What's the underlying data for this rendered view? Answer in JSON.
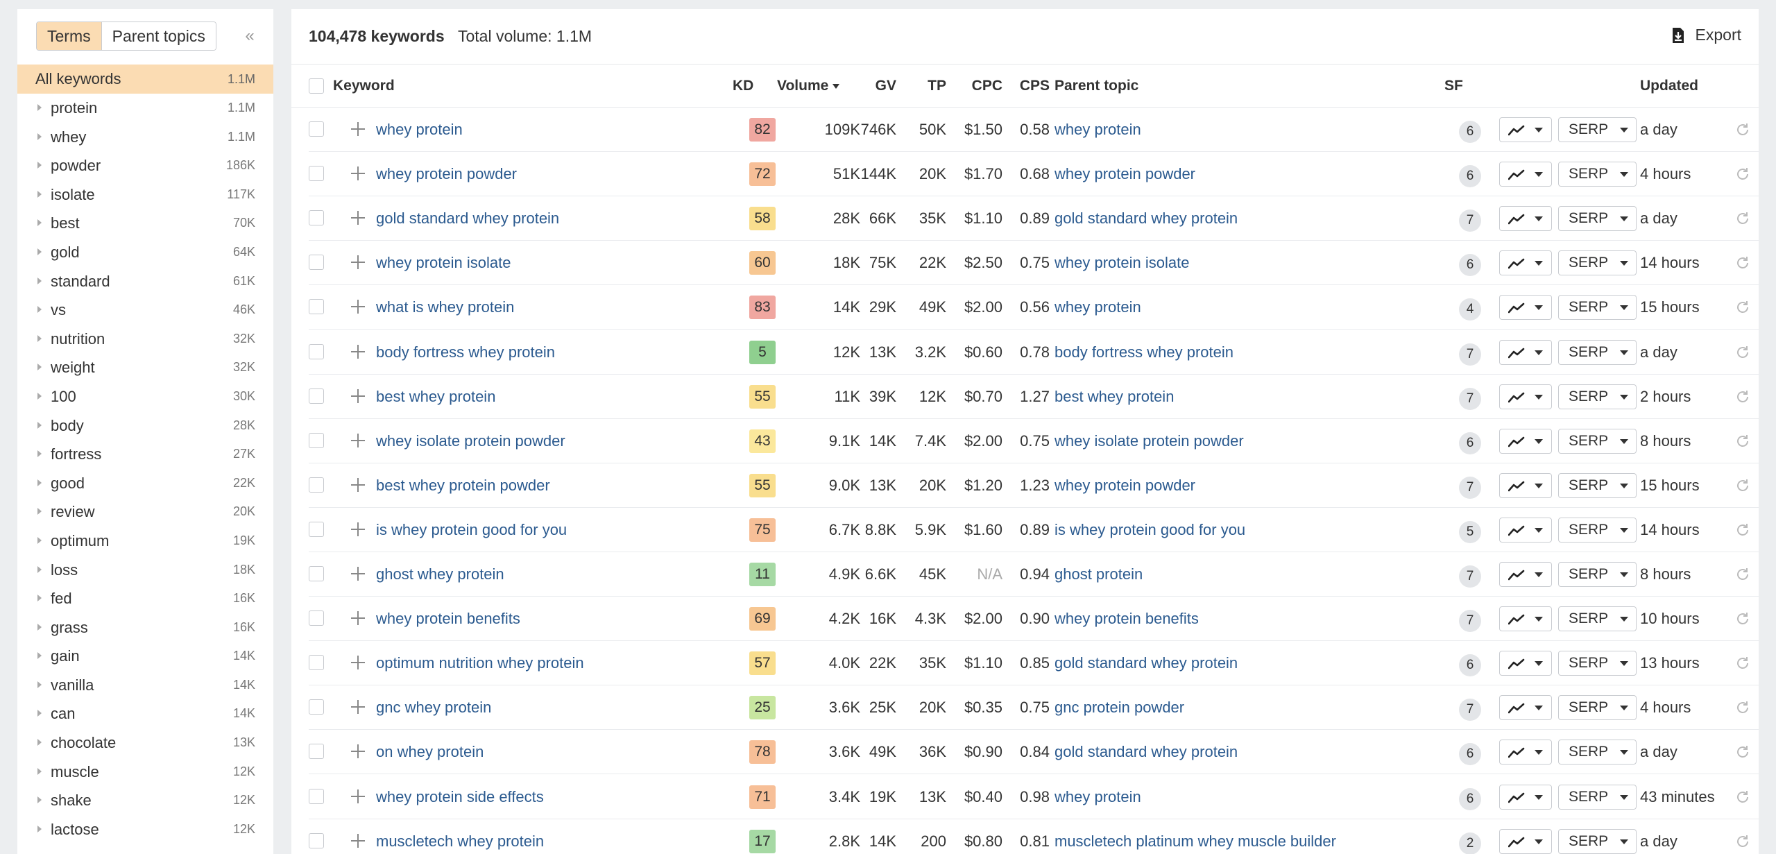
{
  "sidebar": {
    "tabs": [
      "Terms",
      "Parent topics"
    ],
    "all": {
      "label": "All keywords",
      "count": "1.1M"
    },
    "items": [
      {
        "label": "protein",
        "count": "1.1M"
      },
      {
        "label": "whey",
        "count": "1.1M"
      },
      {
        "label": "powder",
        "count": "186K"
      },
      {
        "label": "isolate",
        "count": "117K"
      },
      {
        "label": "best",
        "count": "70K"
      },
      {
        "label": "gold",
        "count": "64K"
      },
      {
        "label": "standard",
        "count": "61K"
      },
      {
        "label": "vs",
        "count": "46K"
      },
      {
        "label": "nutrition",
        "count": "32K"
      },
      {
        "label": "weight",
        "count": "32K"
      },
      {
        "label": "100",
        "count": "30K"
      },
      {
        "label": "body",
        "count": "28K"
      },
      {
        "label": "fortress",
        "count": "27K"
      },
      {
        "label": "good",
        "count": "22K"
      },
      {
        "label": "review",
        "count": "20K"
      },
      {
        "label": "optimum",
        "count": "19K"
      },
      {
        "label": "loss",
        "count": "18K"
      },
      {
        "label": "fed",
        "count": "16K"
      },
      {
        "label": "grass",
        "count": "16K"
      },
      {
        "label": "gain",
        "count": "14K"
      },
      {
        "label": "vanilla",
        "count": "14K"
      },
      {
        "label": "can",
        "count": "14K"
      },
      {
        "label": "chocolate",
        "count": "13K"
      },
      {
        "label": "muscle",
        "count": "12K"
      },
      {
        "label": "shake",
        "count": "12K"
      },
      {
        "label": "lactose",
        "count": "12K"
      }
    ]
  },
  "header": {
    "keyword_count": "104,478 keywords",
    "total_volume": "Total volume: 1.1M",
    "export_label": "Export"
  },
  "columns": {
    "keyword": "Keyword",
    "kd": "KD",
    "volume": "Volume",
    "gv": "GV",
    "tp": "TP",
    "cpc": "CPC",
    "cps": "CPS",
    "parent_topic": "Parent topic",
    "sf": "SF",
    "updated": "Updated"
  },
  "kd_colors": {
    "red": "#f0a7a0",
    "orange": "#f7bf97",
    "yellow": "#f9de8e",
    "light_yellow": "#fbe89c",
    "green": "#a6d9a4",
    "light_green": "#c8e6a0"
  },
  "serp_label": "SERP",
  "rows": [
    {
      "keyword": "whey protein",
      "kd": "82",
      "kd_color": "#f0a7a0",
      "volume": "109K",
      "gv": "746K",
      "tp": "50K",
      "cpc": "$1.50",
      "cps": "0.58",
      "parent": "whey protein",
      "sf": "6",
      "updated": "a day"
    },
    {
      "keyword": "whey protein powder",
      "kd": "72",
      "kd_color": "#f7bf97",
      "volume": "51K",
      "gv": "144K",
      "tp": "20K",
      "cpc": "$1.70",
      "cps": "0.68",
      "parent": "whey protein powder",
      "sf": "6",
      "updated": "4 hours"
    },
    {
      "keyword": "gold standard whey protein",
      "kd": "58",
      "kd_color": "#f9de8e",
      "volume": "28K",
      "gv": "66K",
      "tp": "35K",
      "cpc": "$1.10",
      "cps": "0.89",
      "parent": "gold standard whey protein",
      "sf": "7",
      "updated": "a day"
    },
    {
      "keyword": "whey protein isolate",
      "kd": "60",
      "kd_color": "#f7c792",
      "volume": "18K",
      "gv": "75K",
      "tp": "22K",
      "cpc": "$2.50",
      "cps": "0.75",
      "parent": "whey protein isolate",
      "sf": "6",
      "updated": "14 hours"
    },
    {
      "keyword": "what is whey protein",
      "kd": "83",
      "kd_color": "#f0a7a0",
      "volume": "14K",
      "gv": "29K",
      "tp": "49K",
      "cpc": "$2.00",
      "cps": "0.56",
      "parent": "whey protein",
      "sf": "4",
      "updated": "15 hours"
    },
    {
      "keyword": "body fortress whey protein",
      "kd": "5",
      "kd_color": "#8fcf8f",
      "volume": "12K",
      "gv": "13K",
      "tp": "3.2K",
      "cpc": "$0.60",
      "cps": "0.78",
      "parent": "body fortress whey protein",
      "sf": "7",
      "updated": "a day"
    },
    {
      "keyword": "best whey protein",
      "kd": "55",
      "kd_color": "#f9de8e",
      "volume": "11K",
      "gv": "39K",
      "tp": "12K",
      "cpc": "$0.70",
      "cps": "1.27",
      "parent": "best whey protein",
      "sf": "7",
      "updated": "2 hours"
    },
    {
      "keyword": "whey isolate protein powder",
      "kd": "43",
      "kd_color": "#fbe89c",
      "volume": "9.1K",
      "gv": "14K",
      "tp": "7.4K",
      "cpc": "$2.00",
      "cps": "0.75",
      "parent": "whey isolate protein powder",
      "sf": "6",
      "updated": "8 hours"
    },
    {
      "keyword": "best whey protein powder",
      "kd": "55",
      "kd_color": "#f9de8e",
      "volume": "9.0K",
      "gv": "13K",
      "tp": "20K",
      "cpc": "$1.20",
      "cps": "1.23",
      "parent": "whey protein powder",
      "sf": "7",
      "updated": "15 hours"
    },
    {
      "keyword": "is whey protein good for you",
      "kd": "75",
      "kd_color": "#f7bf97",
      "volume": "6.7K",
      "gv": "8.8K",
      "tp": "5.9K",
      "cpc": "$1.60",
      "cps": "0.89",
      "parent": "is whey protein good for you",
      "sf": "5",
      "updated": "14 hours"
    },
    {
      "keyword": "ghost whey protein",
      "kd": "11",
      "kd_color": "#a6d9a4",
      "volume": "4.9K",
      "gv": "6.6K",
      "tp": "45K",
      "cpc": "N/A",
      "cps": "0.94",
      "parent": "ghost protein",
      "sf": "7",
      "updated": "8 hours"
    },
    {
      "keyword": "whey protein benefits",
      "kd": "69",
      "kd_color": "#f7c792",
      "volume": "4.2K",
      "gv": "16K",
      "tp": "4.3K",
      "cpc": "$2.00",
      "cps": "0.90",
      "parent": "whey protein benefits",
      "sf": "7",
      "updated": "10 hours"
    },
    {
      "keyword": "optimum nutrition whey protein",
      "kd": "57",
      "kd_color": "#f9de8e",
      "volume": "4.0K",
      "gv": "22K",
      "tp": "35K",
      "cpc": "$1.10",
      "cps": "0.85",
      "parent": "gold standard whey protein",
      "sf": "6",
      "updated": "13 hours"
    },
    {
      "keyword": "gnc whey protein",
      "kd": "25",
      "kd_color": "#c8e6a0",
      "volume": "3.6K",
      "gv": "25K",
      "tp": "20K",
      "cpc": "$0.35",
      "cps": "0.75",
      "parent": "gnc protein powder",
      "sf": "7",
      "updated": "4 hours"
    },
    {
      "keyword": "on whey protein",
      "kd": "78",
      "kd_color": "#f7bf97",
      "volume": "3.6K",
      "gv": "49K",
      "tp": "36K",
      "cpc": "$0.90",
      "cps": "0.84",
      "parent": "gold standard whey protein",
      "sf": "6",
      "updated": "a day"
    },
    {
      "keyword": "whey protein side effects",
      "kd": "71",
      "kd_color": "#f7bf97",
      "volume": "3.4K",
      "gv": "19K",
      "tp": "13K",
      "cpc": "$0.40",
      "cps": "0.98",
      "parent": "whey protein",
      "sf": "6",
      "updated": "43 minutes"
    },
    {
      "keyword": "muscletech whey protein",
      "kd": "17",
      "kd_color": "#a6d9a4",
      "volume": "2.8K",
      "gv": "14K",
      "tp": "200",
      "cpc": "$0.80",
      "cps": "0.81",
      "parent": "muscletech platinum whey muscle builder",
      "sf": "2",
      "updated": "a day"
    }
  ]
}
